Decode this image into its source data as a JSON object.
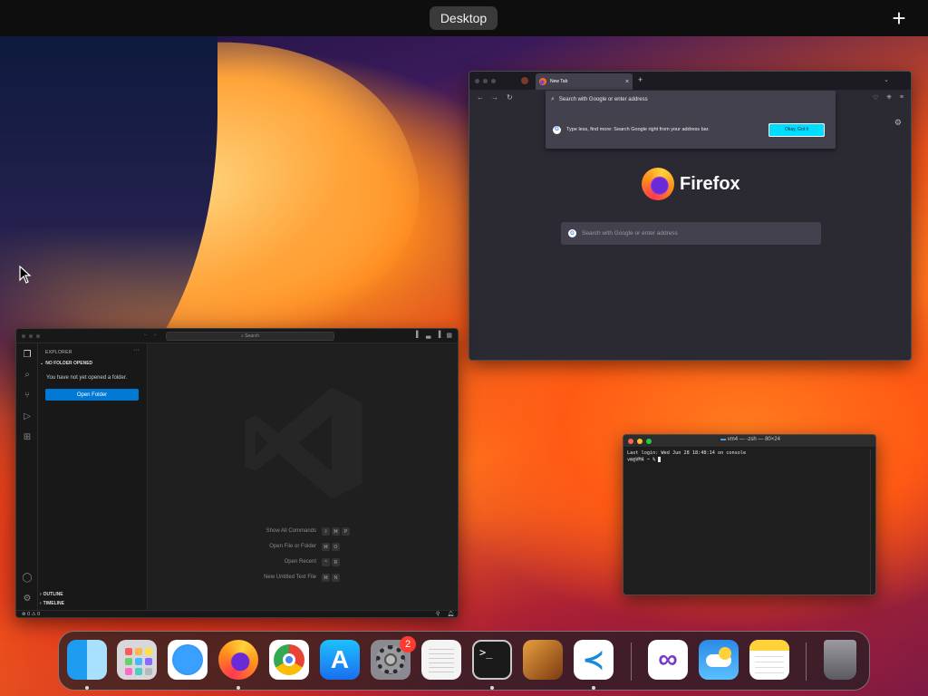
{
  "mission_control": {
    "space_label": "Desktop",
    "add_space": "+"
  },
  "firefox": {
    "tab_title": "New Tab",
    "tab_close": "×",
    "new_tab": "+",
    "urlbar_placeholder": "Search with Google or enter address",
    "suggestion_text": "Type less, find more: Search Google right from your address bar.",
    "suggestion_button": "Okay, Got it",
    "wordmark": "Firefox",
    "search_placeholder": "Search with Google or enter address",
    "google_letter": "G"
  },
  "vscode": {
    "search_label": "Search",
    "explorer_title": "EXPLORER",
    "explorer_more": "···",
    "no_folder_header": "NO FOLDER OPENED",
    "no_folder_msg": "You have not yet opened a folder.",
    "open_folder_button": "Open Folder",
    "outline_header": "OUTLINE",
    "timeline_header": "TIMELINE",
    "shortcuts": [
      {
        "label": "Show All Commands",
        "keys": [
          "⇧",
          "⌘",
          "P"
        ]
      },
      {
        "label": "Open File or Folder",
        "keys": [
          "⌘",
          "O"
        ]
      },
      {
        "label": "Open Recent",
        "keys": [
          "^",
          "R"
        ]
      },
      {
        "label": "New Untitled Text File",
        "keys": [
          "⌘",
          "N"
        ]
      }
    ],
    "status_left": "⊗ 0 ⚠ 0"
  },
  "terminal": {
    "title": "vm4 — -zsh — 80×24",
    "line1": "Last login: Wed Jun 28 18:48:14 on console",
    "line2": "vm@VM4 ~ % "
  },
  "dock": {
    "settings_badge": "2",
    "terminal_prompt": ">_"
  },
  "colors": {
    "firefox_accent": "#00ddff",
    "vscode_accent": "#0078d4",
    "badge_red": "#ff3b30"
  }
}
